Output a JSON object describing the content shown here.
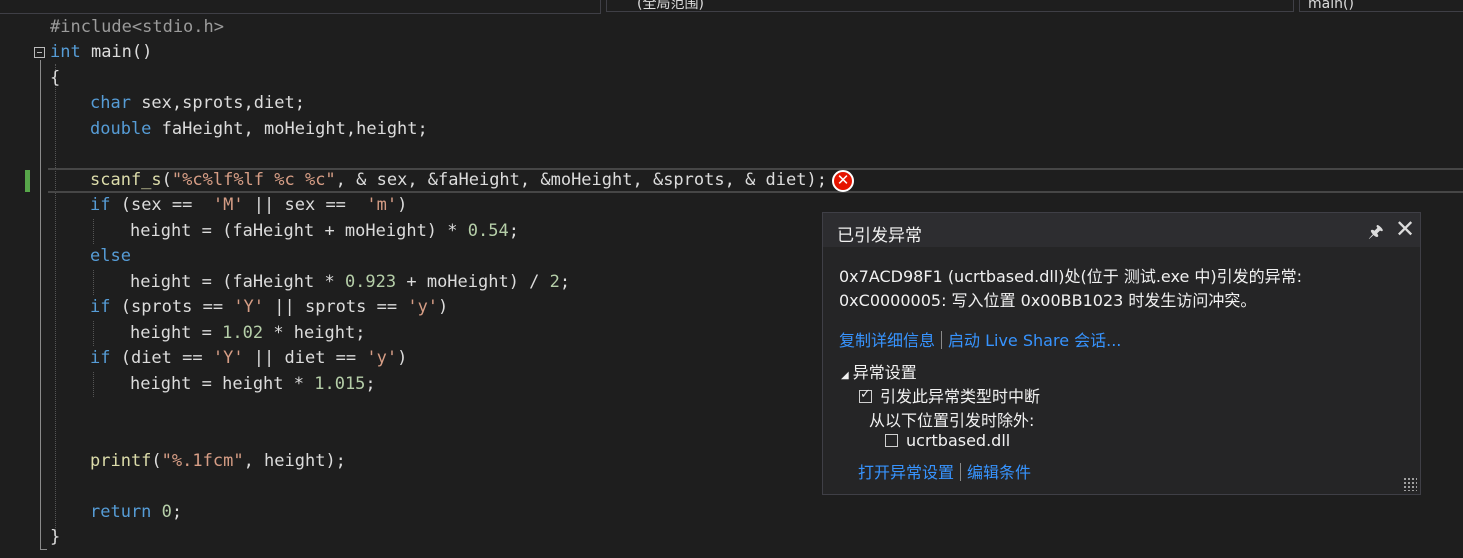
{
  "toolbar": {
    "dropdown_file": "",
    "dropdown_scope": "(全局范围)",
    "dropdown_function": "main()"
  },
  "code": {
    "l1": "#include<stdio.h>",
    "l2_kw": "int",
    "l2_rest": " main()",
    "l3": "{",
    "l4_kw": "char",
    "l4_rest": " sex,sprots,diet;",
    "l5_kw": "double",
    "l5_rest": " faHeight, moHeight,height;",
    "l7_fn": "scanf_s",
    "l7_a": "(",
    "l7_str": "\"%c%lf%lf %c %c\"",
    "l7_rest": ", & sex, &faHeight, &moHeight, &sprots, & diet);",
    "l8_kw": "if",
    "l8_a": " (sex ==  ",
    "l8_s1": "'M'",
    "l8_b": " || sex ==  ",
    "l8_s2": "'m'",
    "l8_c": ")",
    "l9_a": "height = (faHeight + moHeight) * ",
    "l9_n": "0.54",
    "l9_b": ";",
    "l10_kw": "else",
    "l11_a": "height = (faHeight * ",
    "l11_n1": "0.923",
    "l11_b": " + moHeight) / ",
    "l11_n2": "2",
    "l11_c": ";",
    "l12_kw": "if",
    "l12_a": " (sprots == ",
    "l12_s1": "'Y'",
    "l12_b": " || sprots == ",
    "l12_s2": "'y'",
    "l12_c": ")",
    "l13_a": "height = ",
    "l13_n": "1.02",
    "l13_b": " * height;",
    "l14_kw": "if",
    "l14_a": " (diet == ",
    "l14_s1": "'Y'",
    "l14_b": " || diet == ",
    "l14_s2": "'y'",
    "l14_c": ")",
    "l15_a": "height = height * ",
    "l15_n": "1.015",
    "l15_b": ";",
    "l18_fn": "printf",
    "l18_a": "(",
    "l18_str": "\"%.1fcm\"",
    "l18_b": ", height);",
    "l20_kw": "return",
    "l20_n": " 0",
    "l20_b": ";",
    "l21": "}"
  },
  "exception": {
    "title": "已引发异常",
    "pin": "🖈",
    "close": "✕",
    "message_line1": "0x7ACD98F1 (ucrtbased.dll)处(位于 测试.exe 中)引发的异常:",
    "message_line2": "0xC0000005: 写入位置 0x00BB1023 时发生访问冲突。",
    "link_copy": "复制详细信息",
    "link_liveshare": "启动 Live Share 会话...",
    "settings_header": "异常设置",
    "option_break": "引发此异常类型时中断",
    "option_except": "从以下位置引发时除外:",
    "option_dll": "ucrtbased.dll",
    "link_open_settings": "打开异常设置",
    "link_edit_conditions": "编辑条件"
  },
  "colors": {
    "background": "#1e1e1e",
    "keyword": "#569cd6",
    "string": "#d69d85",
    "link": "#3794ff",
    "error": "#e51400"
  }
}
